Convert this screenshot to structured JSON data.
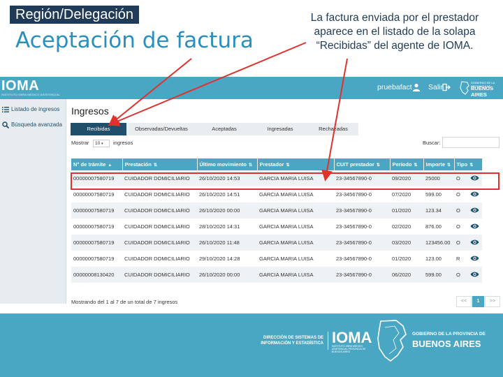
{
  "slide": {
    "region": "Región/Delegación",
    "title": "Aceptación de factura",
    "caption": "La factura enviada por el prestador aparece en el listado de la solapa “Recibidas” del agente de IOMA."
  },
  "topbar": {
    "logo": "IOMA",
    "logo_sub": "INSTITUTO OBRA MÉDICO ASISTENCIAL",
    "user": "pruebafact",
    "logout": "Salir",
    "gov_small": "GOBIERNO DE LA PROVINCIA DE",
    "gov_big": "BUENOS AIRES"
  },
  "sidebar": {
    "items": [
      {
        "label": "Listado de ingresos",
        "icon": "list-icon"
      },
      {
        "label": "Búsqueda avanzada",
        "icon": "search-icon"
      }
    ]
  },
  "main": {
    "heading": "Ingresos",
    "tabs": [
      "Recibidas",
      "Observadas/Devueltas",
      "Aceptadas",
      "Ingresadas",
      "Rechazadas"
    ],
    "active_tab": "Recibidas",
    "show_label": "Mostrar",
    "entries_value": "10",
    "entries_suffix": "ingresos",
    "search_label": "Buscar:"
  },
  "table": {
    "headers": [
      "N° de trámite",
      "Prestación",
      "Último movimiento",
      "Prestador",
      "CUIT prestador",
      "Período",
      "Importe",
      "Tipo"
    ],
    "rows": [
      [
        "00000007580719",
        "CUIDADOR DOMICILIARIO",
        "26/10/2020 14:53",
        "GARCIA MARIA LUISA",
        "23-34567890-0",
        "09/2020",
        "25000",
        "O"
      ],
      [
        "00000007580719",
        "CUIDADOR DOMICILIARIO",
        "26/10/2020 14:51",
        "GARCIA MARIA LUISA",
        "23-34567890-0",
        "07/2020",
        "599.00",
        "O"
      ],
      [
        "00000007580719",
        "CUIDADOR DOMICILIARIO",
        "26/10/2020 00:00",
        "GARCIA MARIA LUISA",
        "23-34567890-0",
        "01/2020",
        "123.34",
        "O"
      ],
      [
        "00000007580719",
        "CUIDADOR DOMICILIARIO",
        "28/10/2020 14:31",
        "GARCIA MARIA LUISA",
        "23-34567890-0",
        "02/2020",
        "876.00",
        "O"
      ],
      [
        "00000007580719",
        "CUIDADOR DOMICILIARIO",
        "26/10/2020 11:48",
        "GARCIA MARIA LUISA",
        "23-34567890-0",
        "03/2020",
        "123456.00",
        "O"
      ],
      [
        "00000007580719",
        "CUIDADOR DOMICILIARIO",
        "29/10/2020 14:28",
        "GARCIA MARIA LUISA",
        "23-34567890-0",
        "01/2020",
        "123.00",
        "R"
      ],
      [
        "00000008130420",
        "CUIDADOR DOMICILIARIO",
        "26/10/2020 00:00",
        "GARCIA MARIA LUISA",
        "23-34567890-0",
        "06/2020",
        "599.00",
        "O"
      ]
    ],
    "info": "Mostrando del 1 al 7 de un total de 7 ingresos",
    "pager": [
      "<<",
      "1",
      ">>"
    ]
  },
  "footer": {
    "direccion": "DIRECCIÓN DE SISTEMAS DE INFORMACIÓN Y ESTADÍSTICA",
    "ioma": "IOMA",
    "ioma_sub": "INSTITUTO OBRA MÉDICO ASISTENCIAL PROVINCIA DE BUENOS AIRES",
    "gov_small": "GOBIERNO DE LA PROVINCIA DE",
    "gov_big": "BUENOS AIRES"
  },
  "colors": {
    "brand": "#4aa7c4",
    "dark": "#1f4f6b",
    "highlight": "#e0312c",
    "title": "#2a8fbd"
  }
}
